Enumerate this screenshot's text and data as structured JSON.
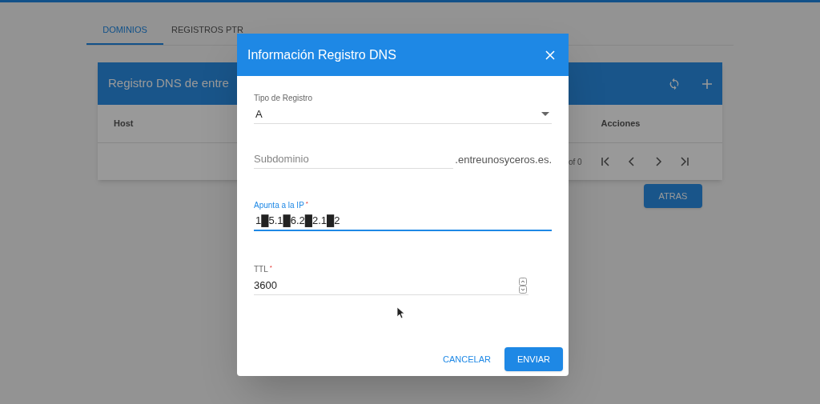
{
  "tabs": [
    {
      "label": "DOMINIOS",
      "selected": true
    },
    {
      "label": "REGISTROS PTR",
      "selected": false
    }
  ],
  "card": {
    "title": "Registro DNS de entre",
    "columns": [
      "Host",
      "Acciones"
    ],
    "pagination": "of 0"
  },
  "back_button": "ATRAS",
  "dialog": {
    "title": "Información Registro DNS",
    "fields": [
      {
        "kind": "select",
        "label": "Tipo de Registro",
        "value": "A"
      },
      {
        "kind": "suffix",
        "placeholder": "Subdominio",
        "suffix": ".entreunosyceros.es."
      },
      {
        "kind": "text",
        "label": "Apunta a la IP",
        "required_mark": "*",
        "value": "1█5.1█6.2█2.1█2",
        "focused": true
      },
      {
        "kind": "number",
        "label": "TTL",
        "required_mark": "*",
        "value": "3600",
        "focused": false
      }
    ],
    "buttons": [
      {
        "label": "CANCELAR",
        "kind": "flat"
      },
      {
        "label": "ENVIAR",
        "kind": "raised"
      }
    ]
  }
}
